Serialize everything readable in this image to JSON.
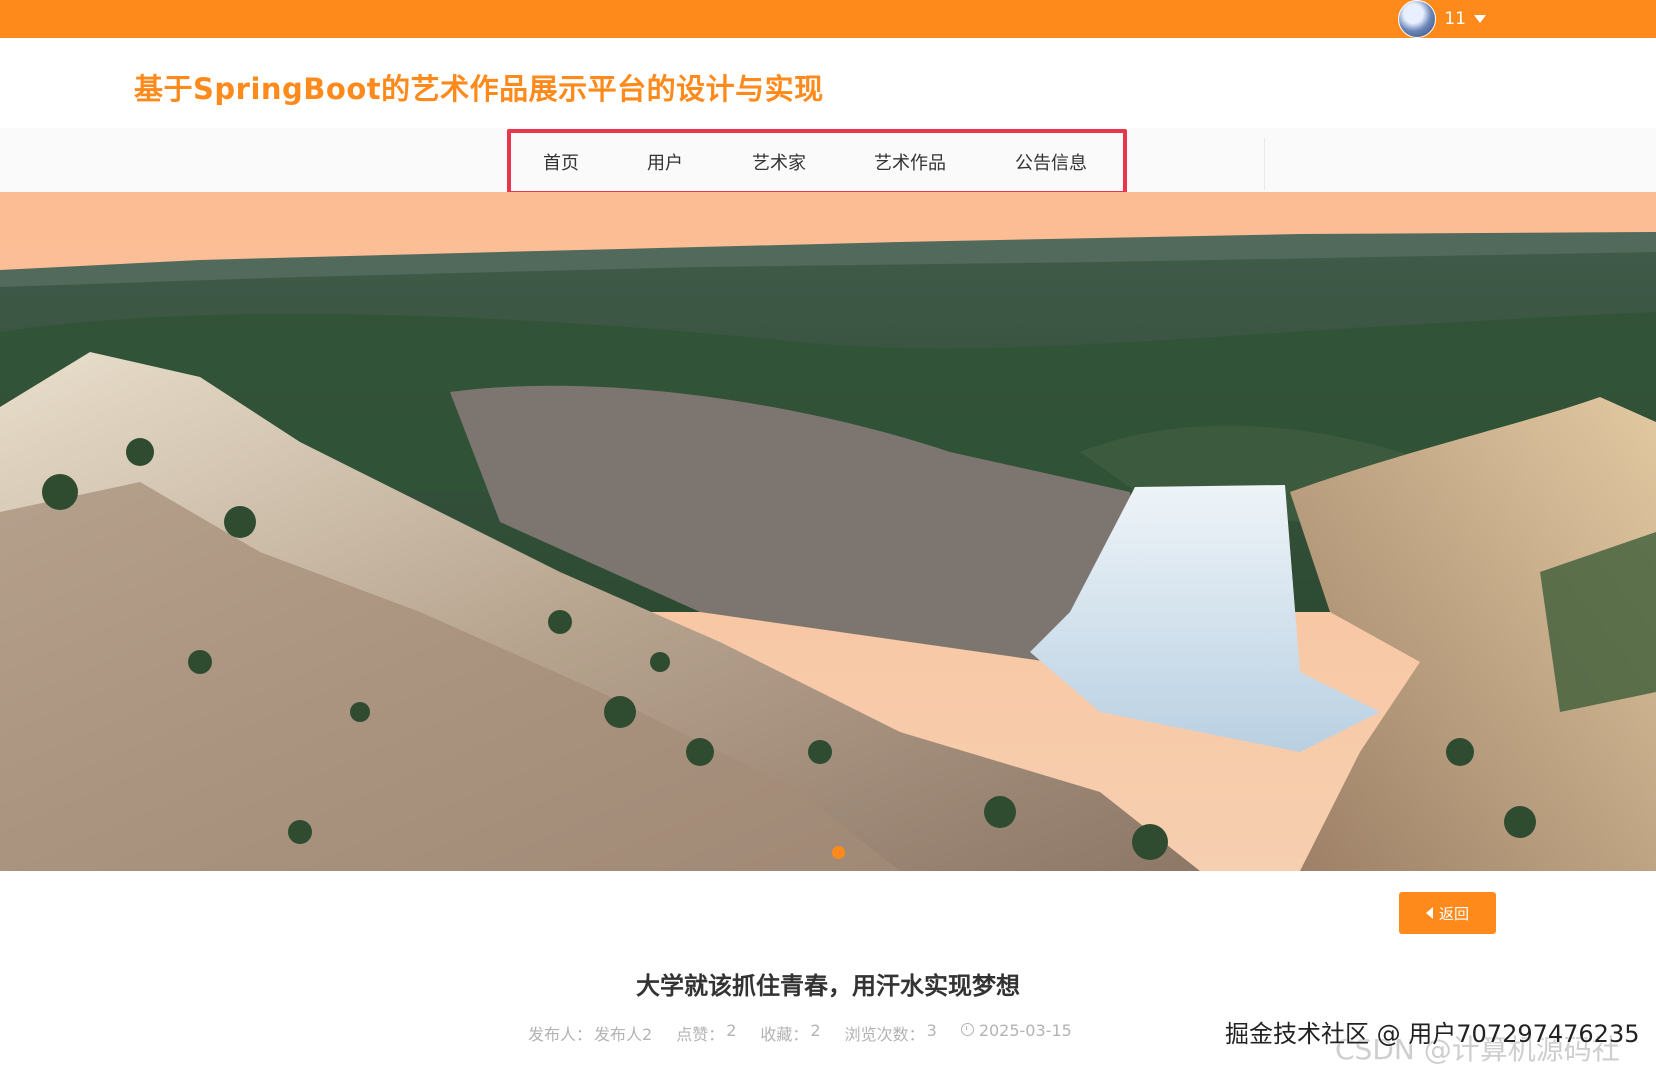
{
  "topbar": {
    "user_name": "11",
    "accent_color": "#ff8a1c"
  },
  "header": {
    "site_title": "基于SpringBoot的艺术作品展示平台的设计与实现"
  },
  "nav": {
    "items": [
      {
        "label": "首页"
      },
      {
        "label": "用户"
      },
      {
        "label": "艺术家"
      },
      {
        "label": "艺术作品"
      },
      {
        "label": "公告信息"
      }
    ],
    "highlight_color": "#e8364e"
  },
  "hero": {
    "image_subject": "waterfall canyon landscape",
    "active_slide": 1
  },
  "article": {
    "back_label": "返回",
    "title": "大学就该抓住青春，用汗水实现梦想",
    "meta": {
      "publisher_label": "发布人：",
      "publisher": "发布人2",
      "likes_label": "点赞：",
      "likes": "2",
      "favorites_label": "收藏：",
      "favorites": "2",
      "views_label": "浏览次数：",
      "views": "3",
      "date": "2025-03-15"
    }
  },
  "watermarks": {
    "primary": "掘金技术社区 @ 用户707297476235",
    "secondary": "CSDN @计算机源码社"
  }
}
